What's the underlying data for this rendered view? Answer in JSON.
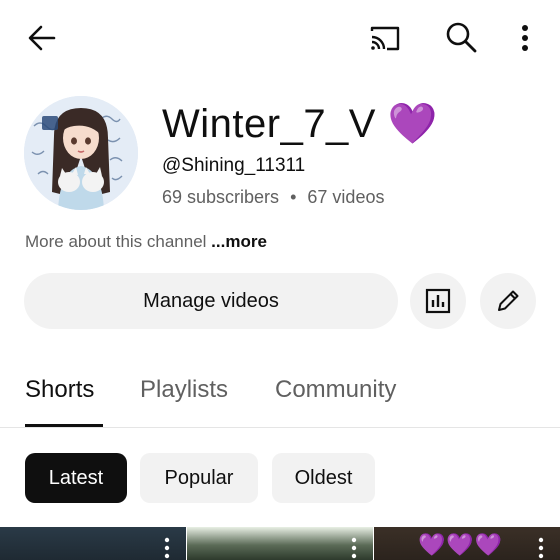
{
  "topbar": {
    "icons": [
      "back-arrow-icon",
      "cast-icon",
      "search-icon",
      "more-vert-icon"
    ]
  },
  "channel": {
    "name": "Winter_7_V",
    "name_emoji": "💜",
    "handle": "@Shining_11311",
    "subscribers": "69 subscribers",
    "separator": "•",
    "videos": "67 videos",
    "about_text": "More about this channel",
    "about_more": " ...more"
  },
  "actions": {
    "manage_label": "Manage videos",
    "analytics_icon": "analytics-icon",
    "edit_icon": "pencil-icon"
  },
  "tabs": [
    {
      "label": "Shorts",
      "active": true
    },
    {
      "label": "Playlists",
      "active": false
    },
    {
      "label": "Community",
      "active": false
    }
  ],
  "chips": [
    {
      "label": "Latest",
      "selected": true
    },
    {
      "label": "Popular",
      "selected": false
    },
    {
      "label": "Oldest",
      "selected": false
    }
  ],
  "thumbnails": [
    {
      "overlay": ""
    },
    {
      "overlay": ""
    },
    {
      "overlay": "💜💜💜"
    }
  ],
  "colors": {
    "text_primary": "#0f0f0f",
    "text_secondary": "#606060",
    "chip_bg": "#f2f2f2",
    "chip_selected_bg": "#0f0f0f",
    "emoji_purple": "#9a55e0"
  }
}
